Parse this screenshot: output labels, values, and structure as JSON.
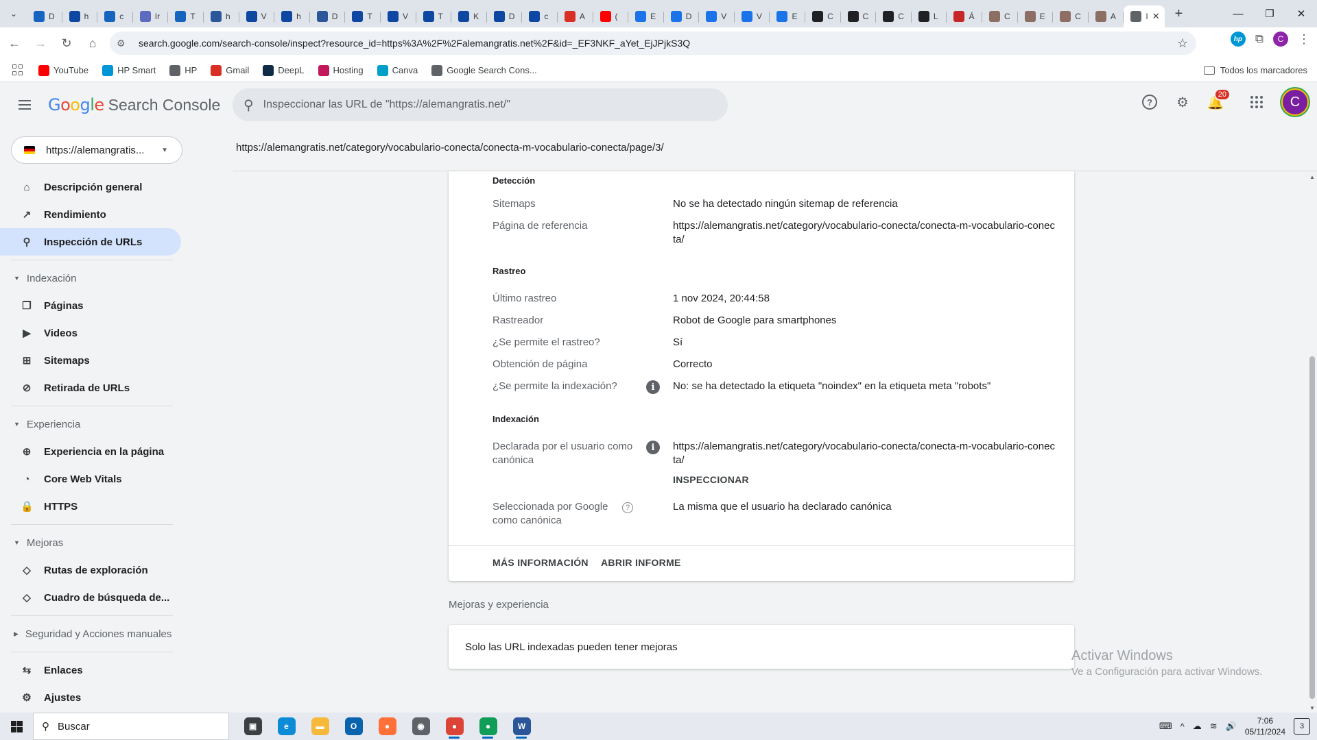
{
  "browser": {
    "tabs": [
      {
        "letter": "D",
        "fav_color": "#1565c0",
        "icon": "cloud-icon"
      },
      {
        "letter": "h",
        "fav_color": "#0d47a1",
        "icon": "globe-icon"
      },
      {
        "letter": "c",
        "fav_color": "#1565c0",
        "icon": "cloud-icon"
      },
      {
        "letter": "Ir",
        "fav_color": "#5c6bc0",
        "icon": "globe-icon"
      },
      {
        "letter": "T",
        "fav_color": "#1565c0",
        "icon": "cloud-icon"
      },
      {
        "letter": "h",
        "fav_color": "#2b579a",
        "icon": "word-icon"
      },
      {
        "letter": "V",
        "fav_color": "#0d47a1",
        "icon": "globe-icon"
      },
      {
        "letter": "h",
        "fav_color": "#0d47a1",
        "icon": "globe-icon"
      },
      {
        "letter": "D",
        "fav_color": "#2b579a",
        "icon": "word-icon"
      },
      {
        "letter": "T",
        "fav_color": "#0d47a1",
        "icon": "globe-icon"
      },
      {
        "letter": "V",
        "fav_color": "#0d47a1",
        "icon": "globe-icon"
      },
      {
        "letter": "T",
        "fav_color": "#0d47a1",
        "icon": "globe-icon"
      },
      {
        "letter": "K",
        "fav_color": "#0d47a1",
        "icon": "globe-icon"
      },
      {
        "letter": "D",
        "fav_color": "#0d47a1",
        "icon": "globe-icon"
      },
      {
        "letter": "c",
        "fav_color": "#0d47a1",
        "icon": "globe-icon"
      },
      {
        "letter": "A",
        "fav_color": "#d93025",
        "icon": "gmail-icon"
      },
      {
        "letter": "(",
        "fav_color": "#ff0000",
        "icon": "youtube-icon"
      },
      {
        "letter": "E",
        "fav_color": "#1a73e8",
        "icon": "shield-heart-icon"
      },
      {
        "letter": "D",
        "fav_color": "#1a73e8",
        "icon": "shield-heart-icon"
      },
      {
        "letter": "V",
        "fav_color": "#1a73e8",
        "icon": "shield-heart-icon"
      },
      {
        "letter": "V",
        "fav_color": "#1a73e8",
        "icon": "shield-heart-icon"
      },
      {
        "letter": "E",
        "fav_color": "#1a73e8",
        "icon": "shield-heart-icon"
      },
      {
        "letter": "C",
        "fav_color": "#202124",
        "icon": "wix-icon"
      },
      {
        "letter": "C",
        "fav_color": "#202124",
        "icon": "wix-icon"
      },
      {
        "letter": "C",
        "fav_color": "#202124",
        "icon": "wix-icon"
      },
      {
        "letter": "L",
        "fav_color": "#202124",
        "icon": "wix-icon"
      },
      {
        "letter": "Á",
        "fav_color": "#c62828",
        "icon": "wordpress-icon"
      },
      {
        "letter": "C",
        "fav_color": "#8d6e63",
        "icon": "german-flag-icon"
      },
      {
        "letter": "E",
        "fav_color": "#8d6e63",
        "icon": "german-flag-icon"
      },
      {
        "letter": "C",
        "fav_color": "#8d6e63",
        "icon": "german-flag-icon"
      },
      {
        "letter": "A",
        "fav_color": "#8d6e63",
        "icon": "german-flag-icon"
      },
      {
        "letter": "I",
        "fav_color": "#5f6368",
        "icon": "search-console-icon",
        "active": true
      }
    ],
    "url": "search.google.com/search-console/inspect?resource_id=https%3A%2F%2Falemangratis.net%2F&id=_EF3NKF_aYet_EjJPjkS3Q",
    "bookmarks": [
      {
        "label": "YouTube",
        "icon": "youtube-icon",
        "color": "#ff0000"
      },
      {
        "label": "HP Smart",
        "icon": "hp-icon",
        "color": "#0096d6"
      },
      {
        "label": "HP",
        "icon": "globe-icon",
        "color": "#5f6368"
      },
      {
        "label": "Gmail",
        "icon": "gmail-icon",
        "color": "#d93025"
      },
      {
        "label": "DeepL",
        "icon": "deepl-icon",
        "color": "#0f2b46"
      },
      {
        "label": "Hosting",
        "icon": "hosting-icon",
        "color": "#c2185b"
      },
      {
        "label": "Canva",
        "icon": "canva-icon",
        "color": "#00a1c9"
      },
      {
        "label": "Google Search Cons...",
        "icon": "search-console-icon",
        "color": "#5f6368"
      }
    ],
    "all_bookmarks": "Todos los marcadores"
  },
  "header": {
    "logo_google": "Google",
    "logo_product": "Search Console",
    "search_placeholder": "Inspeccionar las URL de \"https://alemangratis.net/\"",
    "notifications_count": "20",
    "avatar_letter": "C"
  },
  "sidebar": {
    "property": "https://alemangratis...",
    "items": [
      {
        "type": "item",
        "label": "Descripción general",
        "icon": "home-icon",
        "glyph": "⌂"
      },
      {
        "type": "item",
        "label": "Rendimiento",
        "icon": "trending-up-icon",
        "glyph": "↗"
      },
      {
        "type": "item",
        "label": "Inspección de URLs",
        "icon": "search-icon",
        "glyph": "⚲",
        "active": true
      },
      {
        "type": "divider"
      },
      {
        "type": "section",
        "label": "Indexación"
      },
      {
        "type": "item",
        "label": "Páginas",
        "icon": "pages-icon",
        "glyph": "❐"
      },
      {
        "type": "item",
        "label": "Videos",
        "icon": "video-icon",
        "glyph": "▶"
      },
      {
        "type": "item",
        "label": "Sitemaps",
        "icon": "sitemap-icon",
        "glyph": "⊞"
      },
      {
        "type": "item",
        "label": "Retirada de URLs",
        "icon": "eye-off-icon",
        "glyph": "⊘"
      },
      {
        "type": "divider"
      },
      {
        "type": "section",
        "label": "Experiencia"
      },
      {
        "type": "item",
        "label": "Experiencia en la página",
        "icon": "plus-circle-icon",
        "glyph": "⊕"
      },
      {
        "type": "item",
        "label": "Core Web Vitals",
        "icon": "speed-icon",
        "glyph": "◔"
      },
      {
        "type": "item",
        "label": "HTTPS",
        "icon": "lock-icon",
        "glyph": "🔒"
      },
      {
        "type": "divider"
      },
      {
        "type": "section",
        "label": "Mejoras"
      },
      {
        "type": "item",
        "label": "Rutas de exploración",
        "icon": "layers-icon",
        "glyph": "◇"
      },
      {
        "type": "item",
        "label": "Cuadro de búsqueda de...",
        "icon": "layers-icon",
        "glyph": "◇"
      },
      {
        "type": "divider"
      },
      {
        "type": "section",
        "label": "Seguridad y Acciones manuales",
        "collapsed": true
      },
      {
        "type": "divider"
      },
      {
        "type": "item",
        "label": "Enlaces",
        "icon": "links-icon",
        "glyph": "⇆"
      },
      {
        "type": "item",
        "label": "Ajustes",
        "icon": "gear-icon",
        "glyph": "⚙"
      }
    ]
  },
  "main": {
    "inspected_url": "https://alemangratis.net/category/vocabulario-conecta/conecta-m-vocabulario-conecta/page/3/",
    "detection": {
      "title": "Detección",
      "sitemaps_label": "Sitemaps",
      "sitemaps_value": "No se ha detectado ningún sitemap de referencia",
      "referring_label": "Página de referencia",
      "referring_value": "https://alemangratis.net/category/vocabulario-conecta/conecta-m-vocabulario-conecta/"
    },
    "crawl": {
      "title": "Rastreo",
      "last_crawl_label": "Último rastreo",
      "last_crawl_value": "1 nov 2024, 20:44:58",
      "crawler_label": "Rastreador",
      "crawler_value": "Robot de Google para smartphones",
      "allowed_label": "¿Se permite el rastreo?",
      "allowed_value": "Sí",
      "fetch_label": "Obtención de página",
      "fetch_value": "Correcto",
      "indexing_allowed_label": "¿Se permite la indexación?",
      "indexing_allowed_value": "No: se ha detectado la etiqueta \"noindex\" en la etiqueta meta \"robots\""
    },
    "indexing": {
      "title": "Indexación",
      "user_canonical_label": "Declarada por el usuario como canónica",
      "user_canonical_value": "https://alemangratis.net/category/vocabulario-conecta/conecta-m-vocabulario-conecta/",
      "inspect_button": "INSPECCIONAR",
      "google_canonical_label": "Seleccionada por Google como canónica",
      "google_canonical_value": "La misma que el usuario ha declarado canónica"
    },
    "footer": {
      "more_info": "MÁS INFORMACIÓN",
      "open_report": "ABRIR INFORME"
    },
    "enhancements_title": "Mejoras y experiencia",
    "enhancements_message": "Solo las URL indexadas pueden tener mejoras"
  },
  "watermark": {
    "line1": "Activar Windows",
    "line2": "Ve a Configuración para activar Windows."
  },
  "taskbar": {
    "search_label": "Buscar",
    "apps": [
      {
        "name": "task-view",
        "glyph": "▣",
        "color": "#3c4043"
      },
      {
        "name": "edge",
        "glyph": "e",
        "color": "#0c8bd6"
      },
      {
        "name": "file-explorer",
        "glyph": "▬",
        "color": "#f6b93b"
      },
      {
        "name": "outlook",
        "glyph": "O",
        "color": "#0a64ad"
      },
      {
        "name": "firefox",
        "glyph": "●",
        "color": "#ff7139"
      },
      {
        "name": "camera",
        "glyph": "◉",
        "color": "#5f6368"
      },
      {
        "name": "chrome-profile-c",
        "glyph": "●",
        "color": "#db4437",
        "running": true
      },
      {
        "name": "chrome-profile-a",
        "glyph": "●",
        "color": "#0f9d58",
        "running": true
      },
      {
        "name": "word",
        "glyph": "W",
        "color": "#2b579a",
        "running": true
      }
    ],
    "time": "7:06",
    "date": "05/11/2024",
    "notification_count": "3"
  }
}
